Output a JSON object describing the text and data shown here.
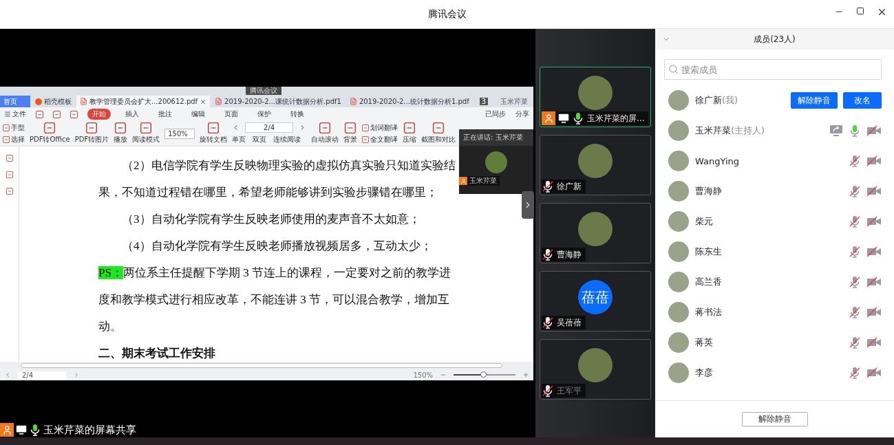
{
  "window": {
    "title": "腾讯会议"
  },
  "shared_screen": {
    "meeting_badge": "腾讯会议",
    "app_tabs": [
      {
        "label": "首页",
        "kind": "home",
        "selected": false
      },
      {
        "label": "稻壳模板",
        "kind": "template",
        "selected": false
      },
      {
        "label": "教学管理委员会扩大...200612.pdf",
        "kind": "pdf",
        "selected": true
      },
      {
        "label": "2019-2020-2...课统计数据分析.pdf1",
        "kind": "pdf",
        "selected": false
      },
      {
        "label": "2019-2020-2...统计数据分析1.pdf",
        "kind": "pdf",
        "selected": false
      }
    ],
    "tab_count": "3",
    "account": "玉米芹菜",
    "menu": [
      {
        "label": "开始",
        "selected": true
      },
      {
        "label": "插入",
        "selected": false
      },
      {
        "label": "批注",
        "selected": false
      },
      {
        "label": "编辑",
        "selected": false
      },
      {
        "label": "页面",
        "selected": false
      },
      {
        "label": "保护",
        "selected": false
      },
      {
        "label": "转换",
        "selected": false
      }
    ],
    "file_menu": "文件",
    "sync": "已同步",
    "share": "分享",
    "toolbar": [
      {
        "kind": "stack",
        "labels": [
          "手型",
          "选择"
        ]
      },
      {
        "kind": "big",
        "label": "PDF转Office"
      },
      {
        "kind": "big",
        "label": "PDF转图片"
      },
      {
        "kind": "big",
        "label": "播放"
      },
      {
        "kind": "big",
        "label": "阅读模式"
      },
      {
        "kind": "zoom",
        "label": "150%"
      },
      {
        "kind": "big",
        "label": "旋转文档"
      },
      {
        "kind": "pager",
        "label": "2/4",
        "labels": [
          "单页",
          "双页",
          "连续阅读"
        ]
      },
      {
        "kind": "big",
        "label": "自动滚动"
      },
      {
        "kind": "big",
        "label": "背景"
      },
      {
        "kind": "stack",
        "labels": [
          "划词翻译",
          "全文翻译"
        ]
      },
      {
        "kind": "big",
        "label": "压缩"
      },
      {
        "kind": "big",
        "label": "截图和对比"
      }
    ],
    "document": [
      {
        "kind": "indented",
        "text": "（2）电信学院有学生反映物理实验的虚拟仿真实验只知道实验结果，不知道过程错在哪里，希望老师能够讲到实验步骤错在哪里；"
      },
      {
        "kind": "indented",
        "text": "（3）自动化学院有学生反映老师使用的麦声音不太如意；"
      },
      {
        "kind": "indented",
        "text": "（4）自动化学院有学生反映老师播放视频居多，互动太少；"
      },
      {
        "kind": "highlighted",
        "marker": "PS：",
        "text": "两位系主任提醒下学期 3 节连上的课程，一定要对之前的教学进度和教学模式进行相应改革，不能连讲 3 节，可以混合教学，增加互动。"
      },
      {
        "kind": "heading",
        "text": "二、期末考试工作安排"
      }
    ],
    "status_bar": {
      "page": "2/4",
      "zoom": "150%",
      "level": 0.48
    },
    "speaker_popup": {
      "title": "正在讲话: 玉米芹菜",
      "name": "玉米芹菜"
    }
  },
  "share_label": "玉米芹菜的屏幕共享",
  "video_tiles": [
    {
      "name": "玉米芹菜的屏...",
      "selected": true,
      "host": true,
      "muted": false,
      "dimmed": false
    },
    {
      "name": "徐广新",
      "selected": false,
      "host": false,
      "muted": true,
      "dimmed": false
    },
    {
      "name": "曹海静",
      "selected": false,
      "host": false,
      "muted": true,
      "dimmed": false
    },
    {
      "name": "吴蓓蓓",
      "avatar_text": "蓓蓓",
      "selected": false,
      "host": false,
      "muted": true,
      "dimmed": false
    },
    {
      "name": "王军平",
      "selected": false,
      "host": false,
      "muted": true,
      "dimmed": true
    }
  ],
  "members": {
    "title": "成员(23人)",
    "search": {
      "placeholder": "搜索成员"
    },
    "list": [
      {
        "name": "徐广新",
        "tag": "(我)",
        "kind": "self",
        "buttons": [
          "解除静音",
          "改名"
        ]
      },
      {
        "name": "玉米芹菜",
        "tag": "(主持人)",
        "kind": "member",
        "sharing": true,
        "muted": false
      },
      {
        "name": "WangYing",
        "kind": "member",
        "sharing": false,
        "muted": true
      },
      {
        "name": "曹海静",
        "kind": "member",
        "sharing": false,
        "muted": true
      },
      {
        "name": "柴元",
        "kind": "member",
        "sharing": false,
        "muted": true
      },
      {
        "name": "陈东生",
        "kind": "member",
        "sharing": false,
        "muted": true
      },
      {
        "name": "高兰香",
        "kind": "member",
        "sharing": false,
        "muted": true
      },
      {
        "name": "蒋书法",
        "kind": "member",
        "sharing": false,
        "muted": true
      },
      {
        "name": "蒋英",
        "kind": "member",
        "sharing": false,
        "muted": true
      },
      {
        "name": "李彦",
        "kind": "member",
        "sharing": false,
        "muted": true
      }
    ],
    "footer_button": "解除静音"
  }
}
